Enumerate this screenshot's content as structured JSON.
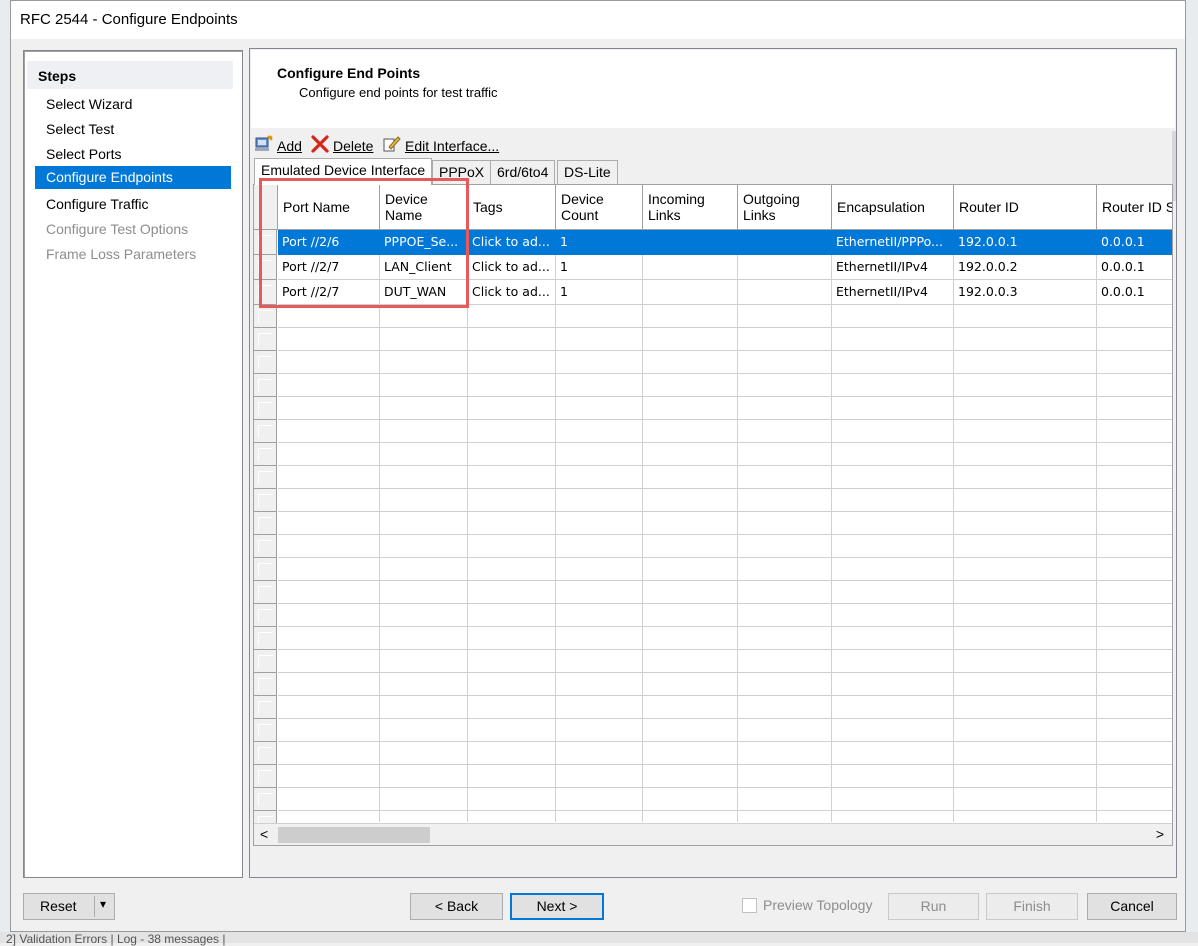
{
  "window": {
    "title": "RFC 2544 - Configure Endpoints"
  },
  "steps": {
    "header": "Steps",
    "items": [
      {
        "label": "Select Wizard",
        "state": "normal"
      },
      {
        "label": "Select Test",
        "state": "normal"
      },
      {
        "label": "Select Ports",
        "state": "normal"
      },
      {
        "label": "Configure Endpoints",
        "state": "active"
      },
      {
        "label": "Configure Traffic",
        "state": "normal"
      },
      {
        "label": "Configure Test Options",
        "state": "disabled"
      },
      {
        "label": "Frame Loss Parameters",
        "state": "disabled"
      }
    ]
  },
  "content": {
    "title": "Configure End Points",
    "subtitle": "Configure end points for test traffic"
  },
  "toolbar": {
    "add_label": "Add",
    "delete_label": "Delete",
    "edit_label": "Edit Interface..."
  },
  "tabs": [
    {
      "label": "Emulated Device Interface",
      "active": true
    },
    {
      "label": "PPPoX",
      "active": false
    },
    {
      "label": "6rd/6to4",
      "active": false
    },
    {
      "label": "DS-Lite",
      "active": false
    }
  ],
  "table": {
    "columns": [
      {
        "line1": "Port Name",
        "line2": ""
      },
      {
        "line1": "Device",
        "line2": "Name"
      },
      {
        "line1": "Tags",
        "line2": ""
      },
      {
        "line1": "Device",
        "line2": "Count"
      },
      {
        "line1": "Incoming",
        "line2": "Links"
      },
      {
        "line1": "Outgoing",
        "line2": "Links"
      },
      {
        "line1": "Encapsulation",
        "line2": ""
      },
      {
        "line1": "Router ID",
        "line2": ""
      },
      {
        "line1": "Router ID S",
        "line2": ""
      }
    ],
    "rows": [
      {
        "selected": true,
        "cells": [
          "Port //2/6",
          "PPPOE_Se...",
          "Click to ad...",
          "1",
          "",
          "",
          "EthernetII/PPPo...",
          "192.0.0.1",
          "0.0.0.1"
        ]
      },
      {
        "selected": false,
        "cells": [
          "Port //2/7",
          "LAN_Client",
          "Click to ad...",
          "1",
          "",
          "",
          "EthernetII/IPv4",
          "192.0.0.2",
          "0.0.0.1"
        ]
      },
      {
        "selected": false,
        "cells": [
          "Port //2/7",
          "DUT_WAN",
          "Click to ad...",
          "1",
          "",
          "",
          "EthernetII/IPv4",
          "192.0.0.3",
          "0.0.0.1"
        ]
      }
    ],
    "scroll_left": "<",
    "scroll_right": ">"
  },
  "footer": {
    "reset_label": "Reset",
    "reset_dropdown": "▾",
    "back_label": "< Back",
    "next_label": "Next >",
    "preview_label": "Preview Topology",
    "run_label": "Run",
    "finish_label": "Finish",
    "cancel_label": "Cancel"
  },
  "status_bar": {
    "text": "2] Validation Errors | Log - 38 messages |"
  }
}
